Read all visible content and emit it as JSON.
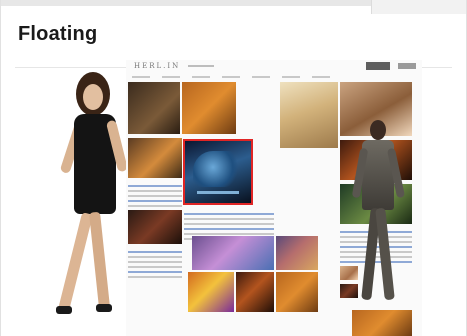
{
  "panel": {
    "title": "Floating"
  },
  "site_screenshot": {
    "logo": "HERL.IN"
  },
  "colors": {
    "title": "#1a1a1a",
    "highlight_border": "#e02525",
    "divider": "#e6e6e6"
  }
}
